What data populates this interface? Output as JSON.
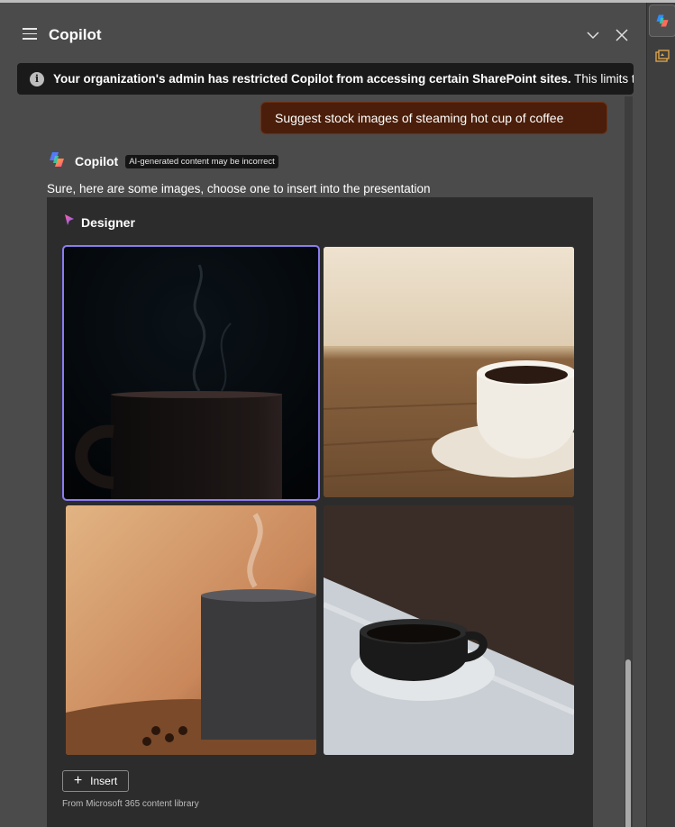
{
  "header": {
    "title": "Copilot"
  },
  "banner": {
    "bold_text": "Your organization's admin has restricted Copilot from accessing certain SharePoint sites.",
    "text": " This limits the"
  },
  "user_message": "Suggest stock images of steaming hot cup of coffee",
  "assistant": {
    "name": "Copilot",
    "badge": "AI-generated content may be incorrect",
    "reply": "Sure, here are some images, choose one to insert into the presentation"
  },
  "designer": {
    "label": "Designer",
    "insert_label": "Insert",
    "source": "From Microsoft 365 content library",
    "images": [
      {
        "name": "dark cup with steam on black background",
        "selected": true
      },
      {
        "name": "white cup and saucer on wooden table",
        "selected": false
      },
      {
        "name": "dark mug with coffee beans warm background",
        "selected": false
      },
      {
        "name": "black cup on white saucer near window light",
        "selected": false
      }
    ]
  },
  "colors": {
    "accent_selection": "#8b7cf0",
    "user_bubble": "#4a1e0a",
    "pane_background": "#4b4b4b"
  }
}
